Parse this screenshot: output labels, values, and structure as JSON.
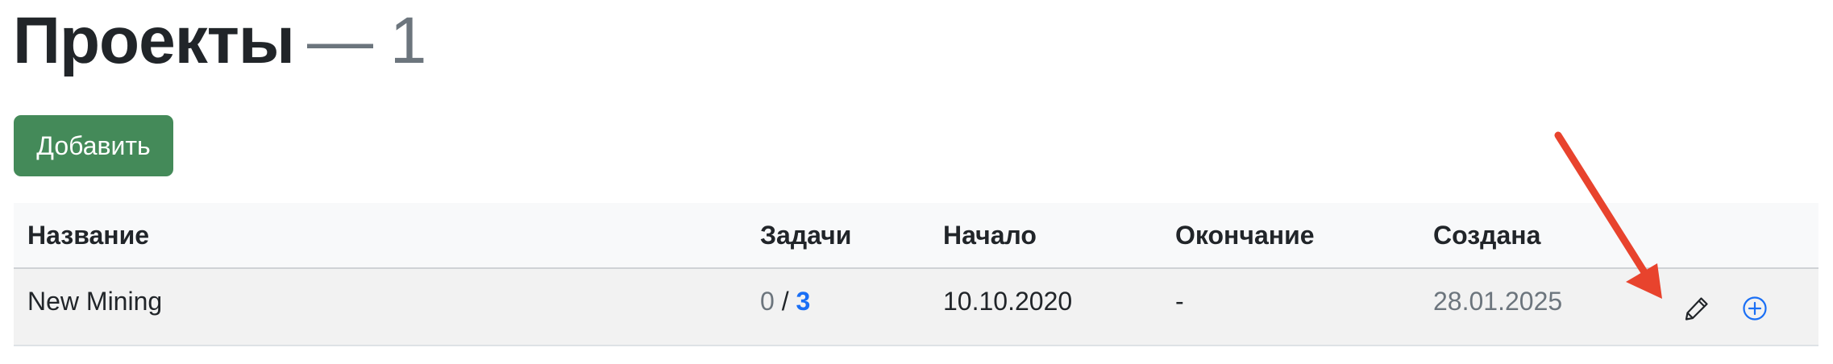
{
  "page": {
    "title": "Проекты",
    "count": "— 1"
  },
  "toolbar": {
    "add_label": "Добавить"
  },
  "table": {
    "headers": {
      "name": "Название",
      "tasks": "Задачи",
      "start": "Начало",
      "end": "Окончание",
      "created": "Создана"
    },
    "rows": [
      {
        "name": "New Mining",
        "tasks_done": "0",
        "tasks_sep": " / ",
        "tasks_total": "3",
        "start": "10.10.2020",
        "end": "-",
        "created": "28.01.2025",
        "actions": [
          "pencil-icon",
          "plus-circle-icon"
        ]
      }
    ]
  },
  "colors": {
    "primary_button": "#448a59",
    "link": "#1a6ff5",
    "annotation_arrow": "#e8432d"
  }
}
